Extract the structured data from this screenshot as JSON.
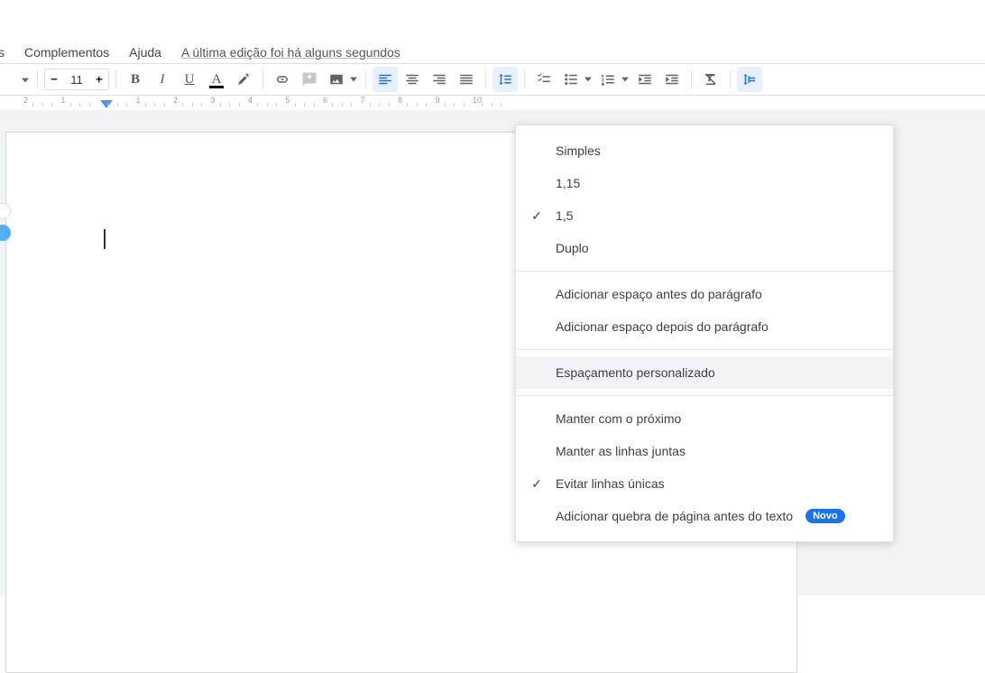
{
  "menubar": {
    "trunc": "s",
    "complementos": "Complementos",
    "ajuda": "Ajuda",
    "edit_status": "A última edição foi há alguns segundos"
  },
  "toolbar": {
    "zoom_value": "",
    "font_size": "11"
  },
  "ruler": {
    "numbers": [
      "2",
      "1",
      "",
      "1",
      "2",
      "3",
      "4",
      "5",
      "6",
      "7",
      "8",
      "9",
      "10"
    ]
  },
  "menu": {
    "simples": "Simples",
    "v115": "1,15",
    "v15": "1,5",
    "duplo": "Duplo",
    "add_before": "Adicionar espaço antes do parágrafo",
    "add_after": "Adicionar espaço depois do parágrafo",
    "custom": "Espaçamento personalizado",
    "keep_next": "Manter com o próximo",
    "keep_lines": "Manter as linhas juntas",
    "avoid_single": "Evitar linhas únicas",
    "page_break": "Adicionar quebra de página antes do texto",
    "badge": "Novo"
  }
}
